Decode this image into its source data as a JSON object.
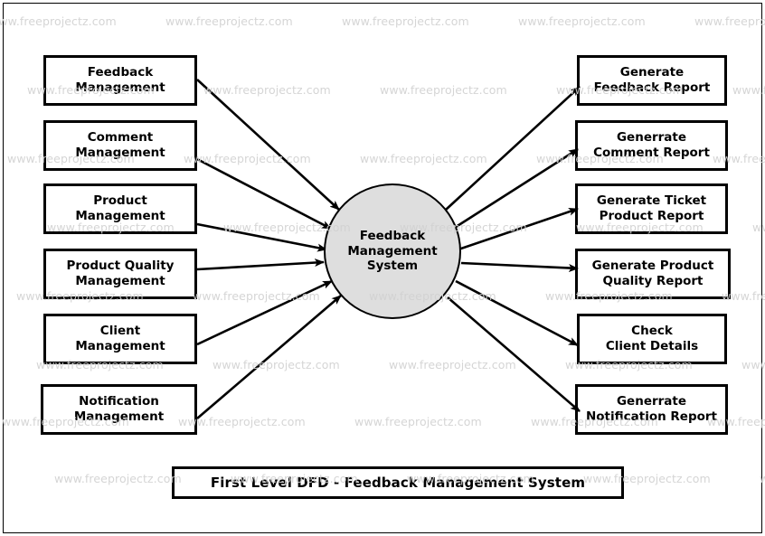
{
  "diagram": {
    "title": "First Level DFD - Feedback Management System",
    "process": {
      "name": "Feedback Management System",
      "label": "Feedback\nManagement\nSystem",
      "fill_color": "#dedede",
      "stroke_color": "#000000"
    },
    "inputs": [
      {
        "id": "feedback-management",
        "label": "Feedback\nManagement"
      },
      {
        "id": "comment-management",
        "label": "Comment\nManagement"
      },
      {
        "id": "product-management",
        "label": "Product\nManagement"
      },
      {
        "id": "product-quality-management",
        "label": "Product Quality\nManagement"
      },
      {
        "id": "client-management",
        "label": "Client\nManagement"
      },
      {
        "id": "notification-management",
        "label": "Notification\nManagement"
      }
    ],
    "outputs": [
      {
        "id": "generate-feedback-report",
        "label": "Generate\nFeedback Report"
      },
      {
        "id": "generate-comment-report",
        "label": "Generrate\nComment Report"
      },
      {
        "id": "generate-ticket-product-report",
        "label": "Generate Ticket\nProduct Report"
      },
      {
        "id": "generate-product-quality-report",
        "label": "Generate Product\nQuality Report"
      },
      {
        "id": "check-client-details",
        "label": "Check\nClient Details"
      },
      {
        "id": "generate-notification-report",
        "label": "Generrate\nNotification Report"
      }
    ],
    "watermark": {
      "text": "www.freeprojectz.com",
      "color": "#d2d2d2"
    }
  }
}
